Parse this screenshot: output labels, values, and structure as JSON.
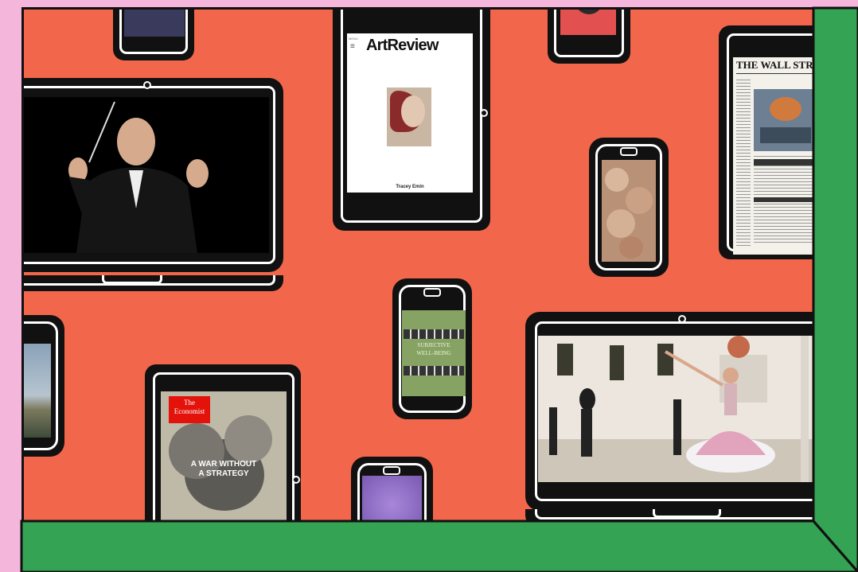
{
  "artreview": {
    "menu_label": "MENU",
    "title": "ArtReview",
    "caption": "Tracey Emin"
  },
  "wsj": {
    "masthead": "THE WALL STREET"
  },
  "economist": {
    "brand_line1": "The",
    "brand_line2": "Economist",
    "headline_line1": "A WAR WITHOUT",
    "headline_line2": "A STRATEGY"
  },
  "book": {
    "line1": "SUBJECTIVE",
    "line2": "WELL-BEING"
  },
  "colors": {
    "background": "#f4b6da",
    "frame": "#f2674b",
    "floor": "#35a354",
    "device": "#111111"
  }
}
